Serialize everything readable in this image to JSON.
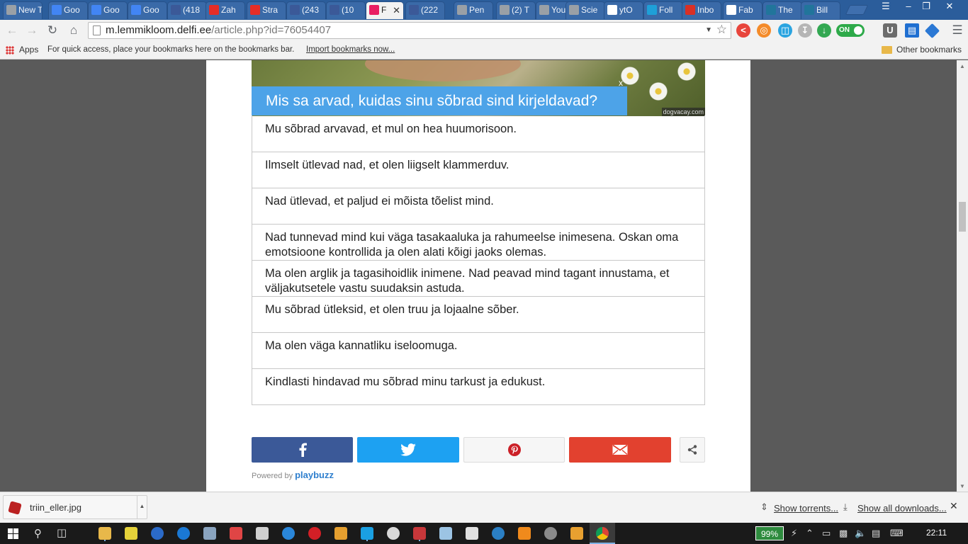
{
  "browser": {
    "tabs": [
      {
        "label": "New Ta",
        "icon": "blank-page-icon",
        "color": "#9aa0a6"
      },
      {
        "label": "Goo",
        "icon": "google-icon",
        "color": "#4285f4"
      },
      {
        "label": "Goo",
        "icon": "google-icon",
        "color": "#4285f4"
      },
      {
        "label": "Goo",
        "icon": "google-icon",
        "color": "#4285f4"
      },
      {
        "label": "(418",
        "icon": "facebook-icon",
        "color": "#3b5998"
      },
      {
        "label": "Zah",
        "icon": "youtube-icon",
        "color": "#e52d27"
      },
      {
        "label": "Stra",
        "icon": "youtube-icon",
        "color": "#e52d27"
      },
      {
        "label": "(243",
        "icon": "facebook-icon",
        "color": "#3b5998"
      },
      {
        "label": "(10",
        "icon": "facebook-icon",
        "color": "#3b5998"
      },
      {
        "label": "F",
        "icon": "paw-icon",
        "color": "#e91e63",
        "active": true
      },
      {
        "label": "(222",
        "icon": "facebook-icon",
        "color": "#3b5998"
      },
      {
        "label": "Pen",
        "icon": "blank-page-icon",
        "color": "#9aa0a6"
      },
      {
        "label": "(2) T",
        "icon": "blank-page-icon",
        "color": "#9aa0a6"
      },
      {
        "label": "You",
        "icon": "blank-page-icon",
        "color": "#9aa0a6"
      },
      {
        "label": "Scie",
        "icon": "blank-page-icon",
        "color": "#9aa0a6"
      },
      {
        "label": "ytO",
        "icon": "yt-icon",
        "color": "#ffffff"
      },
      {
        "label": "Foll",
        "icon": "h-icon",
        "color": "#1ea0d8"
      },
      {
        "label": "Inbo",
        "icon": "gmail-icon",
        "color": "#d93025"
      },
      {
        "label": "Fab",
        "icon": "spiral-icon",
        "color": "#ffffff"
      },
      {
        "label": "The",
        "icon": "wordpress-icon",
        "color": "#21759b"
      },
      {
        "label": "Bill",
        "icon": "wordpress-icon",
        "color": "#21759b"
      }
    ],
    "window_controls": {
      "user": "☰",
      "minimize": "–",
      "restore": "❐",
      "close": "✕"
    },
    "url_host": "m.lemmikloom.delfi.ee",
    "url_path": "/article.php?id=76054407",
    "toggle_label": "ON",
    "bookmarks": {
      "apps_label": "Apps",
      "hint": "For quick access, place your bookmarks here on the bookmarks bar.",
      "import_link": "Import bookmarks now...",
      "other": "Other bookmarks"
    }
  },
  "quiz": {
    "photo_credit": "dogvacay.com",
    "question": "Mis sa arvad, kuidas sinu sõbrad sind kirjeldavad?",
    "close_label": "x",
    "answers": [
      "Mu sõbrad arvavad, et mul on hea huumorisoon.",
      "Ilmselt ütlevad nad, et olen liigselt klammerduv.",
      "Nad ütlevad, et paljud ei mõista tõelist mind.",
      "Nad tunnevad mind kui väga tasakaaluka ja rahumeelse inimesena. Oskan oma emotsioone kontrollida ja olen alati kõigi jaoks olemas.",
      "Ma olen arglik ja tagasihoidlik inimene. Nad peavad mind tagant innustama, et väljakutsetele vastu suudaksin astuda.",
      "Mu sõbrad ütleksid, et olen truu ja lojaalne sõber.",
      "Ma olen väga kannatliku iseloomuga.",
      "Kindlasti hindavad mu sõbrad minu tarkust ja edukust."
    ],
    "share": {
      "facebook_color": "#3b5998",
      "twitter_color": "#1da1f2",
      "pinterest_color": "#cb2027",
      "email_color": "#e2412f"
    },
    "powered_by": "Powered by",
    "brand": "playbuzz"
  },
  "downloads": {
    "file": "triin_eller.jpg",
    "show_torrents": "Show torrents...",
    "show_all": "Show all downloads..."
  },
  "taskbar": {
    "battery": "99%",
    "time": "22:11"
  }
}
